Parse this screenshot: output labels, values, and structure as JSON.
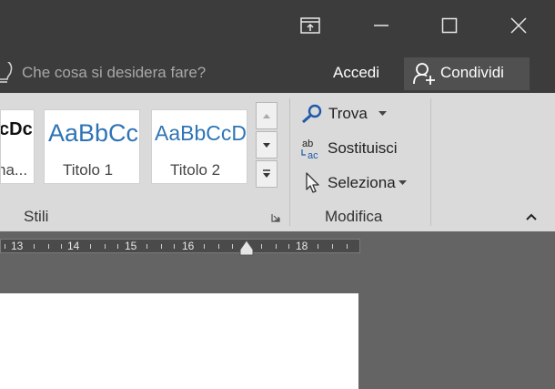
{
  "window": {
    "controls": [
      "ribbon-display-options",
      "minimize",
      "maximize",
      "close"
    ]
  },
  "tellme": {
    "placeholder": "Che cosa si desidera fare?",
    "accedi": "Accedi",
    "share": "Condividi"
  },
  "styles": {
    "items": [
      {
        "sample": "cDc",
        "name": "na..."
      },
      {
        "sample": "AaBbCc",
        "name": "Titolo 1"
      },
      {
        "sample": "AaBbCcD",
        "name": "Titolo 2"
      }
    ],
    "group_label": "Stili"
  },
  "modifica": {
    "trova": "Trova",
    "sostituisci": "Sostituisci",
    "seleziona": "Seleziona",
    "group_label": "Modifica"
  },
  "ruler": {
    "numbers": [
      "13",
      "14",
      "15",
      "16",
      "18"
    ]
  },
  "colors": {
    "titlebar": "#3c3c3c",
    "ribbon": "#dadada",
    "heading_blue": "#2e74b5",
    "workspace": "#646464"
  }
}
